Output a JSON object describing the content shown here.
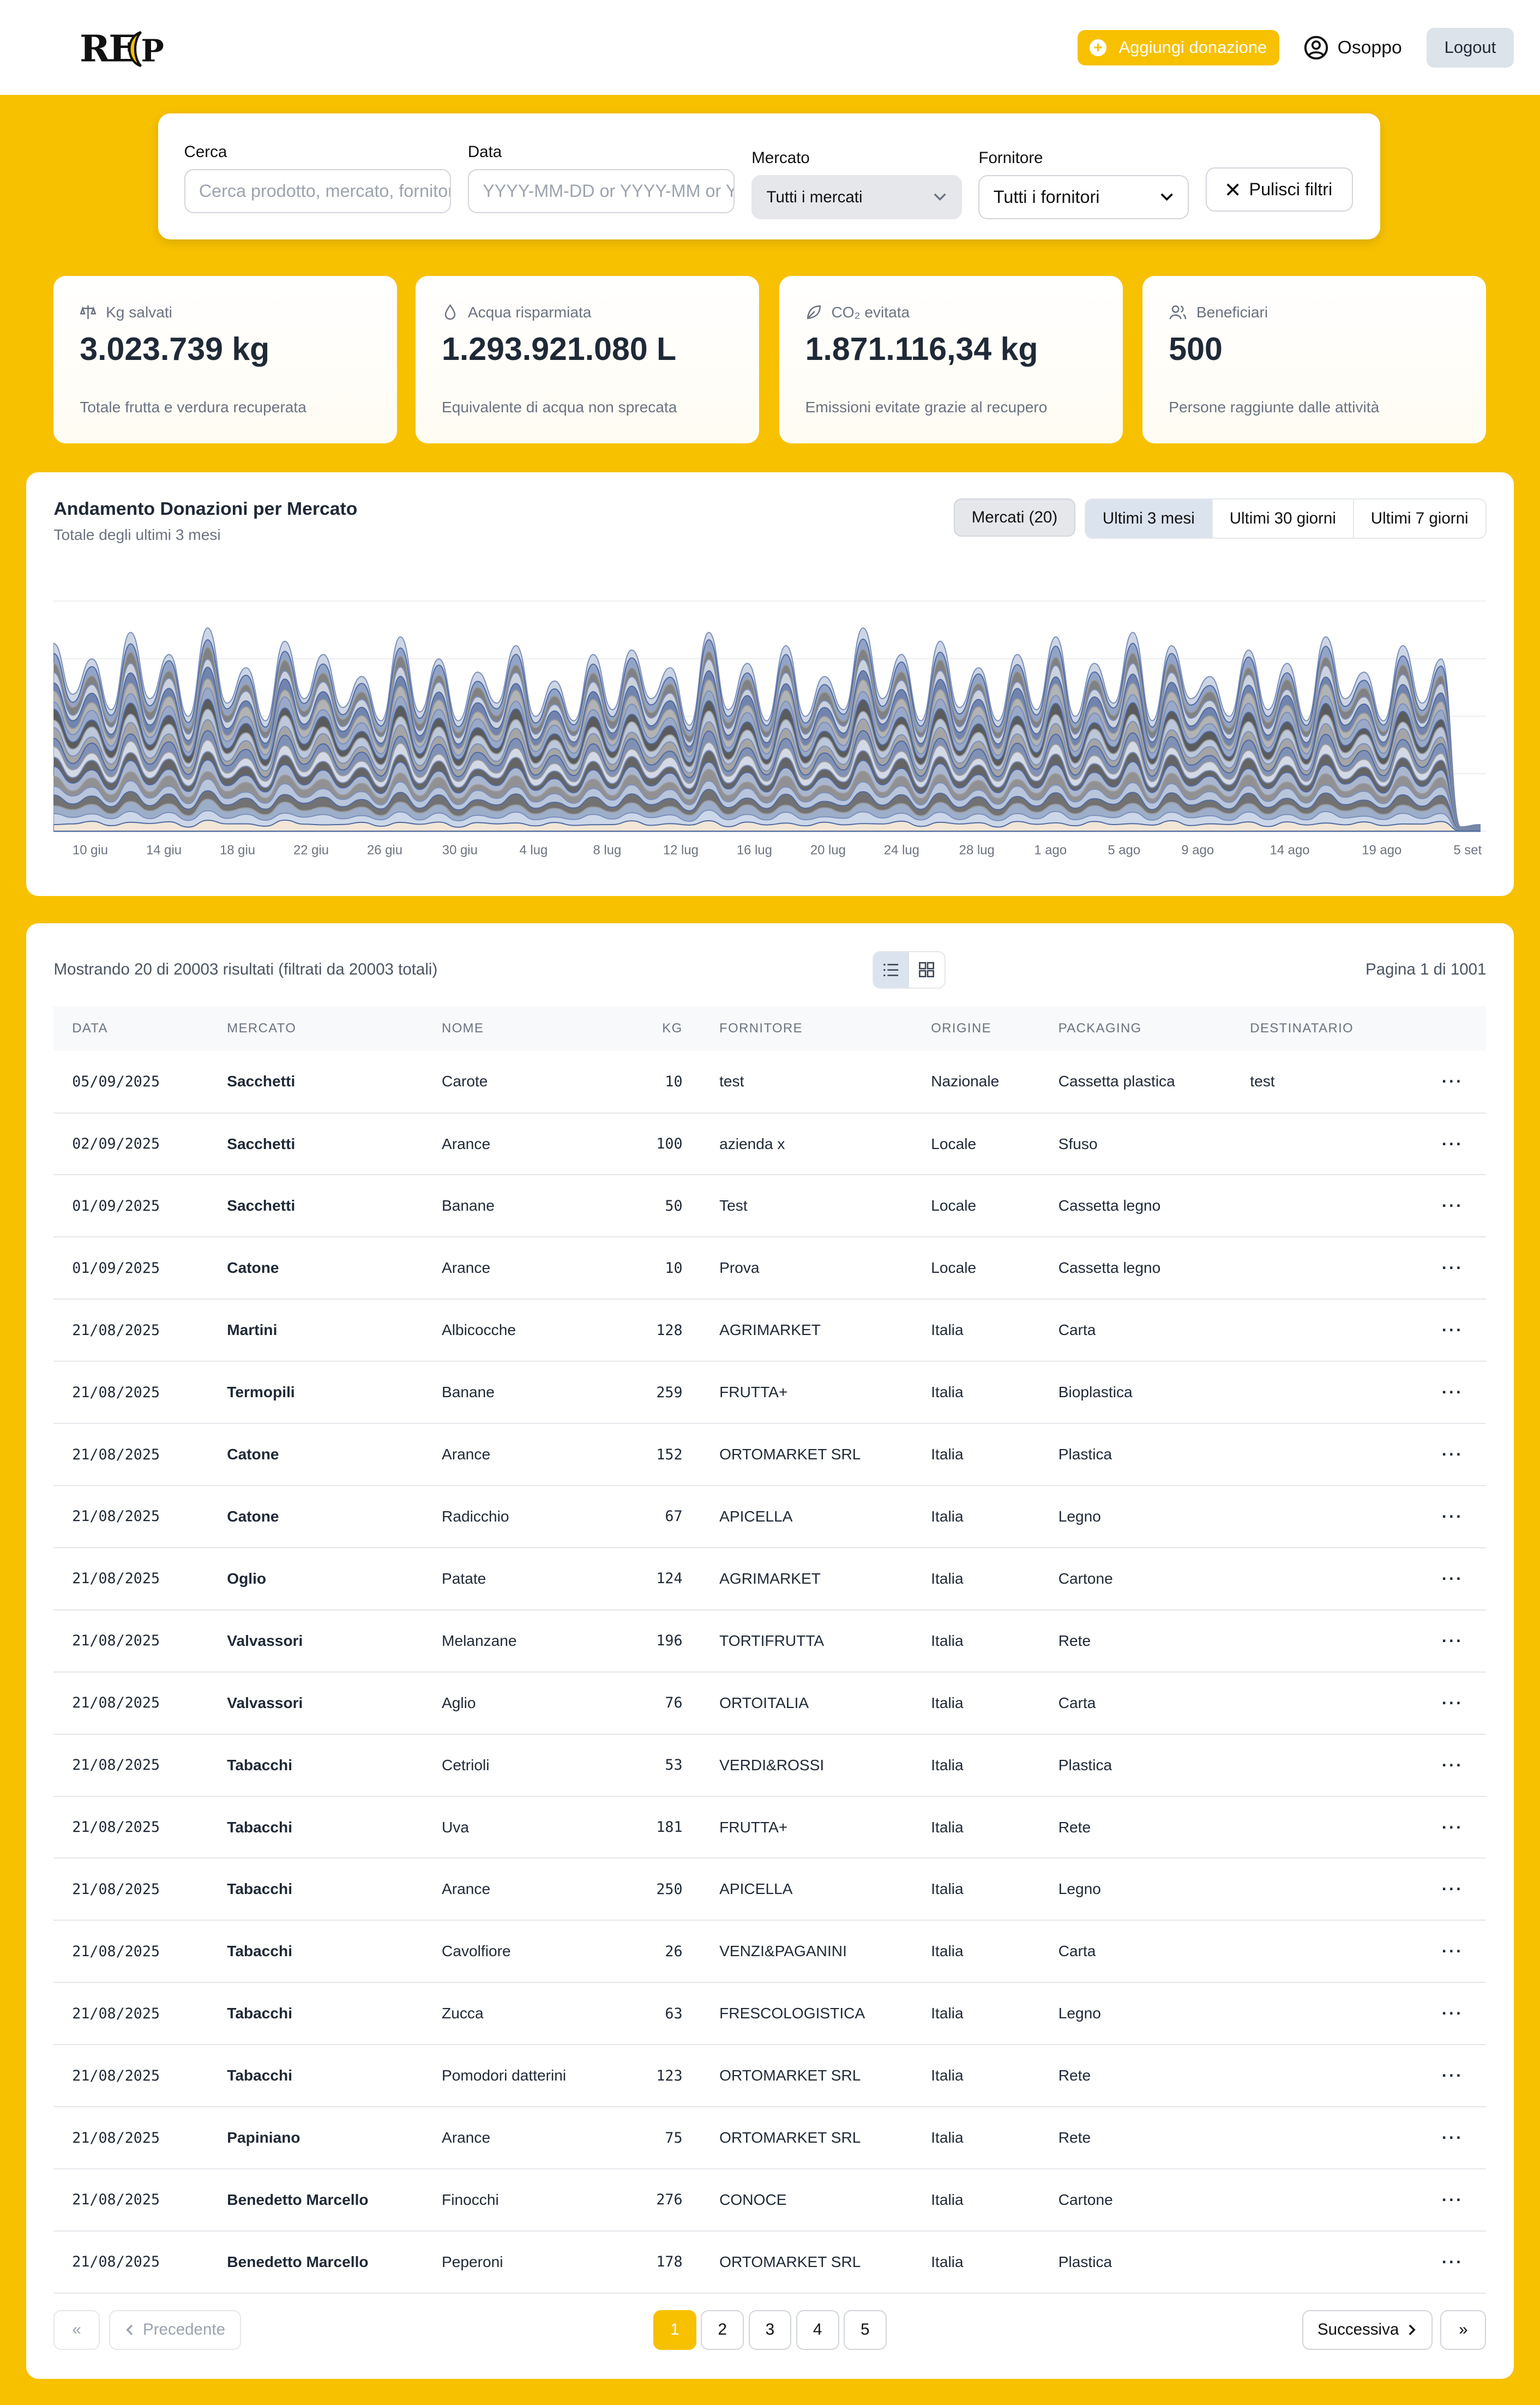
{
  "header": {
    "logo_text": "RECUP",
    "donate_label": "Aggiungi donazione",
    "user_name": "Osoppo",
    "logout_label": "Logout"
  },
  "filters": {
    "search_label": "Cerca",
    "search_placeholder": "Cerca prodotto, mercato, fornitore",
    "date_label": "Data",
    "date_placeholder": "YYYY-MM-DD or YYYY-MM or YYYY",
    "market_label": "Mercato",
    "market_value": "Tutti i mercati",
    "supplier_label": "Fornitore",
    "supplier_value": "Tutti i fornitori",
    "clear_label": "Pulisci filtri"
  },
  "stats": [
    {
      "icon": "scale-icon",
      "label": "Kg salvati",
      "value": "3.023.739 kg",
      "sub": "Totale frutta e verdura recuperata"
    },
    {
      "icon": "droplet-icon",
      "label": "Acqua risparmiata",
      "value": "1.293.921.080 L",
      "sub": "Equivalente di acqua non sprecata"
    },
    {
      "icon": "leaf-icon",
      "label": "CO₂ evitata",
      "value": "1.871.116,34 kg",
      "sub": "Emissioni evitate grazie al recupero"
    },
    {
      "icon": "users-icon",
      "label": "Beneficiari",
      "value": "500",
      "sub": "Persone raggiunte dalle attività"
    }
  ],
  "chart": {
    "title": "Andamento Donazioni per Mercato",
    "subtitle": "Totale degli ultimi 3 mesi",
    "markets_button": "Mercati (20)",
    "ranges": [
      "Ultimi 3 mesi",
      "Ultimi 30 giorni",
      "Ultimi 7 giorni"
    ],
    "active_range": "Ultimi 3 mesi"
  },
  "chart_data": {
    "type": "area",
    "stacked": true,
    "streamgraph": true,
    "series_count": 20,
    "x_tick_labels": [
      "10 giu",
      "14 giu",
      "18 giu",
      "22 giu",
      "26 giu",
      "30 giu",
      "4 lug",
      "8 lug",
      "12 lug",
      "16 lug",
      "20 lug",
      "24 lug",
      "28 lug",
      "1 ago",
      "5 ago",
      "9 ago",
      "14 ago",
      "19 ago",
      "5 set"
    ],
    "total_envelope": [
      0.85,
      0.62,
      0.78,
      0.55,
      0.9,
      0.6,
      0.8,
      0.52,
      0.92,
      0.58,
      0.74,
      0.5,
      0.86,
      0.6,
      0.8,
      0.56,
      0.7,
      0.5,
      0.88,
      0.54,
      0.78,
      0.5,
      0.72,
      0.58,
      0.84,
      0.52,
      0.68,
      0.5,
      0.8,
      0.55,
      0.82,
      0.6,
      0.74,
      0.48,
      0.9,
      0.55,
      0.76,
      0.5,
      0.84,
      0.52,
      0.7,
      0.55,
      0.92,
      0.6,
      0.8,
      0.5,
      0.86,
      0.56,
      0.74,
      0.5,
      0.8,
      0.55,
      0.88,
      0.52,
      0.76,
      0.58,
      0.9,
      0.5,
      0.84,
      0.6,
      0.7,
      0.52,
      0.82,
      0.55,
      0.76,
      0.5,
      0.88,
      0.6,
      0.72,
      0.5,
      0.84,
      0.58,
      0.78,
      0.02,
      0.03
    ],
    "grid": true,
    "legend": "none"
  },
  "table": {
    "info": "Mostrando 20 di 20003 risultati (filtrati da 20003 totali)",
    "page_info": "Pagina 1 di 1001",
    "columns": [
      "DATA",
      "MERCATO",
      "NOME",
      "KG",
      "FORNITORE",
      "ORIGINE",
      "PACKAGING",
      "DESTINATARIO"
    ],
    "rows": [
      [
        "05/09/2025",
        "Sacchetti",
        "Carote",
        "10",
        "test",
        "Nazionale",
        "Cassetta plastica",
        "test"
      ],
      [
        "02/09/2025",
        "Sacchetti",
        "Arance",
        "100",
        "azienda x",
        "Locale",
        "Sfuso",
        ""
      ],
      [
        "01/09/2025",
        "Sacchetti",
        "Banane",
        "50",
        "Test",
        "Locale",
        "Cassetta legno",
        ""
      ],
      [
        "01/09/2025",
        "Catone",
        "Arance",
        "10",
        "Prova",
        "Locale",
        "Cassetta legno",
        ""
      ],
      [
        "21/08/2025",
        "Martini",
        "Albicocche",
        "128",
        "AGRIMARKET",
        "Italia",
        "Carta",
        ""
      ],
      [
        "21/08/2025",
        "Termopili",
        "Banane",
        "259",
        "FRUTTA+",
        "Italia",
        "Bioplastica",
        ""
      ],
      [
        "21/08/2025",
        "Catone",
        "Arance",
        "152",
        "ORTOMARKET SRL",
        "Italia",
        "Plastica",
        ""
      ],
      [
        "21/08/2025",
        "Catone",
        "Radicchio",
        "67",
        "APICELLA",
        "Italia",
        "Legno",
        ""
      ],
      [
        "21/08/2025",
        "Oglio",
        "Patate",
        "124",
        "AGRIMARKET",
        "Italia",
        "Cartone",
        ""
      ],
      [
        "21/08/2025",
        "Valvassori",
        "Melanzane",
        "196",
        "TORTIFRUTTA",
        "Italia",
        "Rete",
        ""
      ],
      [
        "21/08/2025",
        "Valvassori",
        "Aglio",
        "76",
        "ORTOITALIA",
        "Italia",
        "Carta",
        ""
      ],
      [
        "21/08/2025",
        "Tabacchi",
        "Cetrioli",
        "53",
        "VERDI&ROSSI",
        "Italia",
        "Plastica",
        ""
      ],
      [
        "21/08/2025",
        "Tabacchi",
        "Uva",
        "181",
        "FRUTTA+",
        "Italia",
        "Rete",
        ""
      ],
      [
        "21/08/2025",
        "Tabacchi",
        "Arance",
        "250",
        "APICELLA",
        "Italia",
        "Legno",
        ""
      ],
      [
        "21/08/2025",
        "Tabacchi",
        "Cavolfiore",
        "26",
        "VENZI&PAGANINI",
        "Italia",
        "Carta",
        ""
      ],
      [
        "21/08/2025",
        "Tabacchi",
        "Zucca",
        "63",
        "FRESCOLOGISTICA",
        "Italia",
        "Legno",
        ""
      ],
      [
        "21/08/2025",
        "Tabacchi",
        "Pomodori datterini",
        "123",
        "ORTOMARKET SRL",
        "Italia",
        "Rete",
        ""
      ],
      [
        "21/08/2025",
        "Papiniano",
        "Arance",
        "75",
        "ORTOMARKET SRL",
        "Italia",
        "Rete",
        ""
      ],
      [
        "21/08/2025",
        "Benedetto Marcello",
        "Finocchi",
        "276",
        "CONOCE",
        "Italia",
        "Cartone",
        ""
      ],
      [
        "21/08/2025",
        "Benedetto Marcello",
        "Peperoni",
        "178",
        "ORTOMARKET SRL",
        "Italia",
        "Plastica",
        ""
      ]
    ]
  },
  "pagination": {
    "first_symbol": "«",
    "prev_label": "Precedente",
    "pages": [
      "1",
      "2",
      "3",
      "4",
      "5"
    ],
    "current_page": "1",
    "next_label": "Successiva",
    "last_symbol": "»"
  },
  "colors": {
    "brand_yellow": "#f7c100",
    "chart_blue": "#5a75a8",
    "chart_grey": "#6b6b6b"
  }
}
